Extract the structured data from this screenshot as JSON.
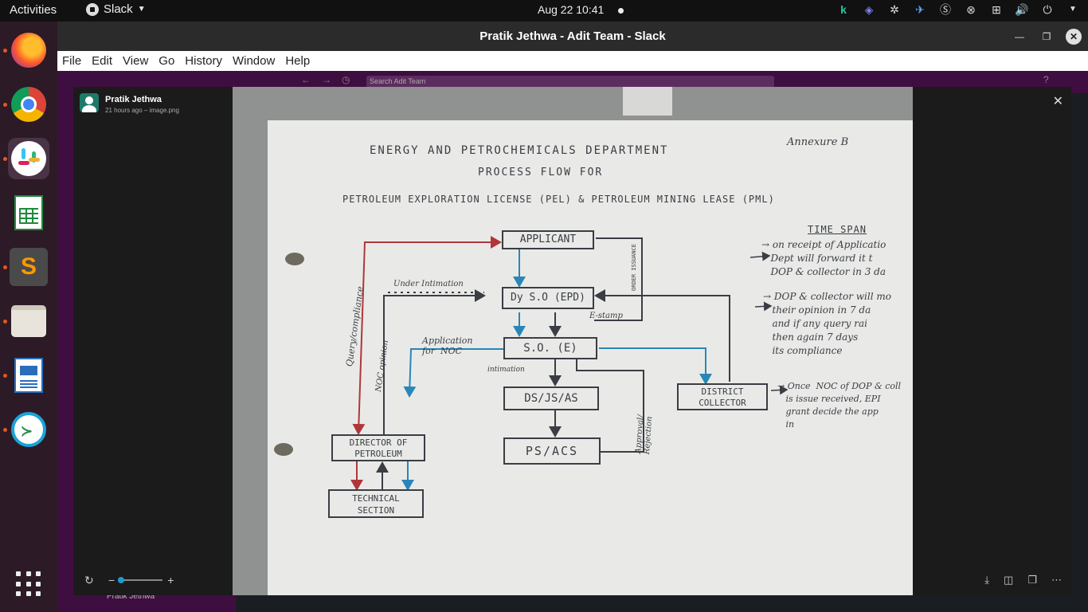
{
  "topbar": {
    "activities": "Activities",
    "app_name": "Slack",
    "clock": "Aug 22  10:41"
  },
  "window": {
    "title": "Pratik Jethwa - Adit Team - Slack",
    "menu": [
      "File",
      "Edit",
      "View",
      "Go",
      "History",
      "Window",
      "Help"
    ],
    "search_placeholder": "Search Adit Team",
    "footer_user": "Pratik Jethwa"
  },
  "viewer": {
    "poster": "Pratik Jethwa",
    "meta": "21 hours ago – image.png",
    "zoom_level": 0.0
  },
  "photo": {
    "header_line1": "ENERGY   AND   PETROCHEMICALS   DEPARTMENT",
    "annexure": "Annexure B",
    "header_line2": "PROCESS  FLOW  FOR",
    "header_line3": "PETROLEUM  EXPLORATION  LICENSE (PEL) &  PETROLEUM  MINING LEASE (PML)",
    "boxes": {
      "applicant": "APPLICANT",
      "dyso": "Dy S.O (EPD)",
      "so": "S.O. (E)",
      "dsjsas": "DS/JS/AS",
      "psacs": "PS/ACS",
      "director": "DIRECTOR OF\nPETROLEUM",
      "technical": "TECHNICAL\nSECTION",
      "district": "DISTRICT\nCOLLECTOR"
    },
    "labels": {
      "under_intimation": "Under Intimation",
      "query": "Query/compliance",
      "noc_opinion": "NOC opinion",
      "application_noc": "Application\nfor  NOC",
      "intimation": "intimation",
      "estamp": "E-stamp",
      "order_issuance": "ORDER ISSUANCE",
      "approval_rejection": "Approval/\nRejection"
    },
    "time_span": {
      "title": "TIME  SPAN",
      "notes": [
        "→ on receipt of Applicatio\n   Dept will forward it t\n   DOP & collector in 3 da",
        "→ DOP & collector will mo\n   their opinion in 7 da\n   and if any query rai\n   then again 7 days\n   its compliance",
        "→ Once  NOC of DOP & coll\n   is issue received, EPI\n   grant decide the app\n   in"
      ]
    }
  }
}
